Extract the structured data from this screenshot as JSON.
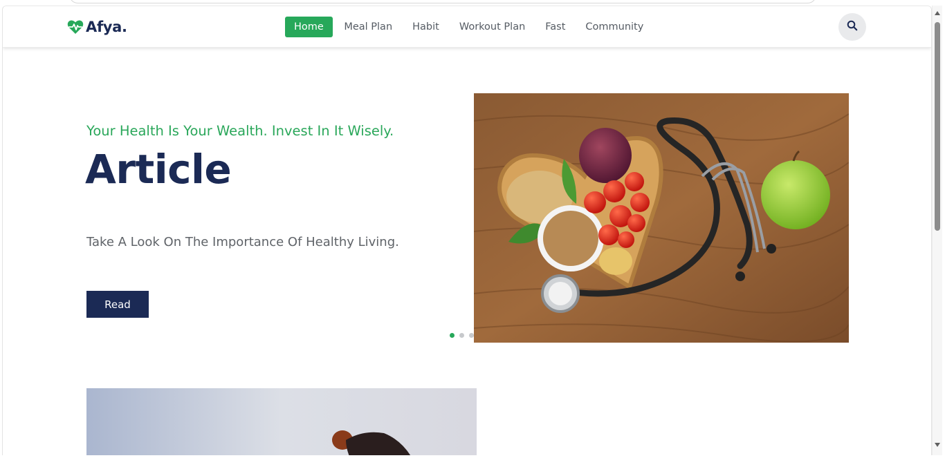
{
  "brand": {
    "name": "Afya.",
    "logo_icon": "heartbeat-icon",
    "accent_color": "#27a85a",
    "primary_color": "#1b2a55"
  },
  "nav": {
    "items": [
      {
        "label": "Home",
        "active": true
      },
      {
        "label": "Meal Plan",
        "active": false
      },
      {
        "label": "Habit",
        "active": false
      },
      {
        "label": "Workout Plan",
        "active": false
      },
      {
        "label": "Fast",
        "active": false
      },
      {
        "label": "Community",
        "active": false
      }
    ],
    "search_icon": "search-icon"
  },
  "hero": {
    "tagline": "Your Health Is Your Wealth. Invest In It Wisely.",
    "title": "Article",
    "description": "Take A Look On The Importance Of Healthy Living.",
    "button_label": "Read",
    "image_subject": "heart-shaped bowl of vegetables with stethoscope and apple on wooden table",
    "carousel": {
      "slides": 3,
      "active_index": 0
    }
  },
  "next_section": {
    "image_subject": "person with backpack against sky"
  }
}
